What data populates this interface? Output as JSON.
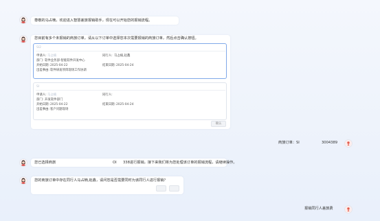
{
  "messages": {
    "welcome": "尊敬的马占楠，欢迎进入智慧差旅报销助手，现在可以开始您的报销流程。",
    "multi_orders": "您目前有多个未报销的商旅订单，请从以下订单中选择您本次需要报销的商旅订单，然后点击确认按钮。",
    "selected_prefix": "您已选择商旅",
    "selected_mid": "OI",
    "selected_suffix": "338进行报销，接下来我们将为您处理该订单的报销流程，请继续操作。",
    "companion_question": "您的商旅订单中存在同行人马占楠,赵鑫，请问您是否需要同时为该同行人进行报销？"
  },
  "orders": [
    {
      "order_no": "SI2",
      "applicant_label": "申请人:",
      "applicant_value": "马占楠",
      "companion_label": "同行人:",
      "companion_value": "马占楠,赵鑫",
      "dept_label": "部门:",
      "dept_value": "软件业务部-智能软件开发中心",
      "start_label": "开始日期:",
      "start_value": "2025-04-22",
      "end_label": "结束日期:",
      "end_value": "2025-04-24",
      "reason_label": "出差事由:",
      "reason_value": "软件研发项目现场工作协调",
      "selected": true
    },
    {
      "order_no": "SI",
      "applicant_label": "申请人:",
      "applicant_value": "马占楠",
      "companion_label": "同行人:",
      "companion_value": "",
      "dept_label": "部门:",
      "dept_value": "开发软件部门",
      "start_label": "开始日期:",
      "start_value": "2025-04-22",
      "end_label": "结束日期:",
      "end_value": "2025-04-24",
      "reason_label": "出差事由:",
      "reason_value": "客户问题现场",
      "selected": false
    }
  ],
  "confirm_button": "确认",
  "user_messages": {
    "order_selected_prefix": "商旅订单：SI",
    "order_selected_suffix": "3004389",
    "companion_reply": "报销同行人差旅费"
  },
  "colors": {
    "accent": "#3a6fd8",
    "avatar_bg": "#fde9e6",
    "user_avatar": "#e25a4a"
  }
}
